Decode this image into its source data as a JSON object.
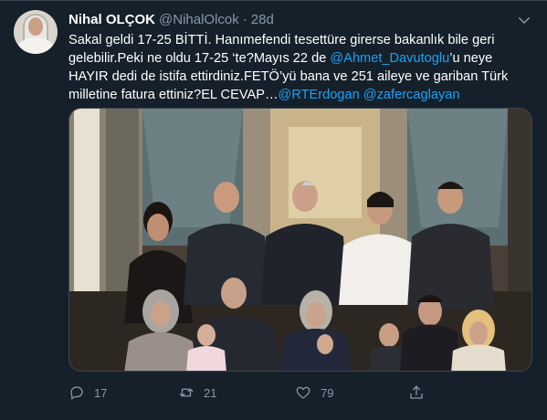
{
  "tweet": {
    "author_name": "Nihal OLÇOK",
    "handle": "@NihalOlcok",
    "separator": "·",
    "time": "28d",
    "text_segments": [
      {
        "text": "Sakal geldi 17-25 BİTTİ. Hanımefendi tesettüre girerse bakanlık bile geri gelebilir.Peki ne oldu 17-25 ‘te?Mayıs 22 de ",
        "mention": false
      },
      {
        "text": "@Ahmet_Davutoglu",
        "mention": true
      },
      {
        "text": "’u neye HAYIR dedi de istifa ettirdiniz.FETÖ’yü bana ve 251 aileye ve gariban Türk milletine fatura ettiniz?EL CEVAP…",
        "mention": false
      },
      {
        "text": "@RTErdogan",
        "mention": true
      },
      {
        "text": " ",
        "mention": false
      },
      {
        "text": "@zafercaglayan",
        "mention": true
      }
    ],
    "photo_alt": "family-photo",
    "actions": {
      "replies": "17",
      "retweets": "21",
      "likes": "79"
    }
  },
  "icons": [
    "reply-icon",
    "retweet-icon",
    "like-icon",
    "share-icon",
    "chevron-down-icon"
  ],
  "colors": {
    "background": "#15202b",
    "text": "#ffffff",
    "muted": "#8899a6",
    "accent": "#1da1f2",
    "border": "#38444d"
  }
}
